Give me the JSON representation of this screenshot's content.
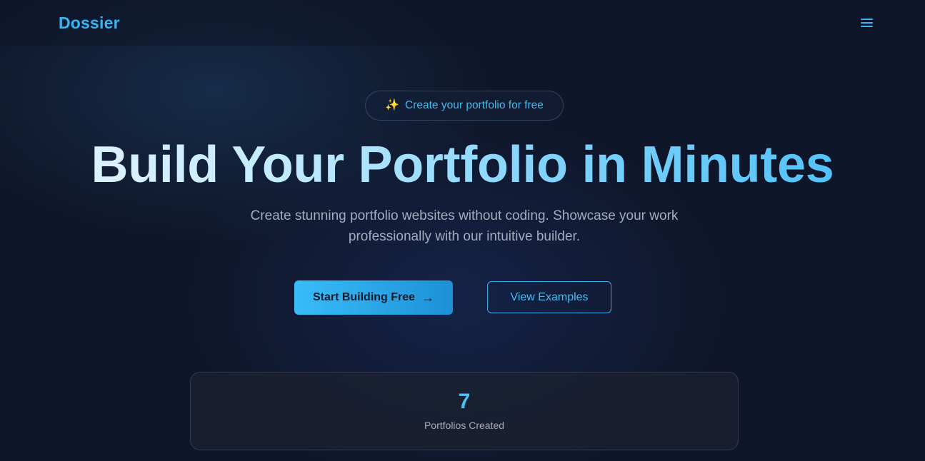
{
  "brand": {
    "logo": "Dossier"
  },
  "nav": {
    "menu_icon": "hamburger-menu-icon"
  },
  "hero": {
    "badge_icon": "sparkles-icon",
    "badge_text": "Create your portfolio for free",
    "headline": "Build Your Portfolio in Minutes",
    "subtitle_line1": "Create stunning portfolio websites without coding. Showcase your work",
    "subtitle_line2": "professionally with our intuitive builder.",
    "primary_cta": "Start Building Free",
    "primary_cta_icon": "arrow-right-icon",
    "secondary_cta": "View Examples"
  },
  "stats": [
    {
      "value": "7",
      "label": "Portfolios Created"
    }
  ],
  "colors": {
    "accent": "#38bdf8",
    "background": "#0f1629",
    "muted_text": "#a3adbe"
  }
}
